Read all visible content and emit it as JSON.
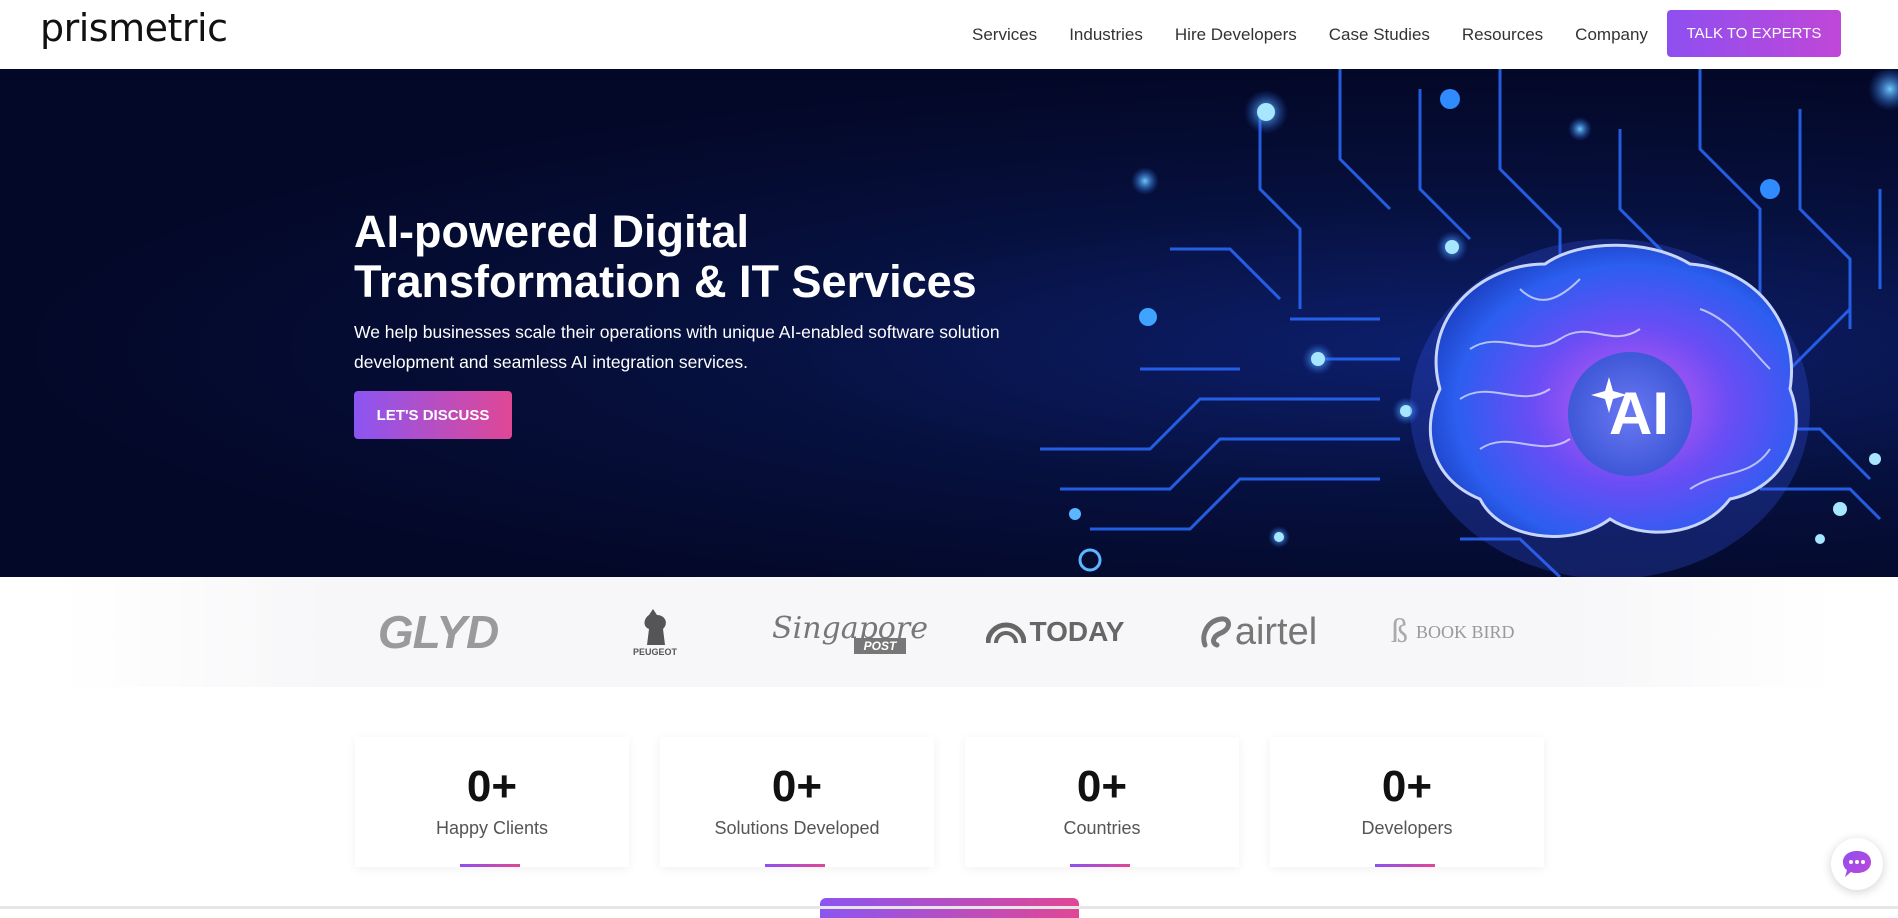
{
  "header": {
    "logo": "prismetric",
    "nav": [
      "Services",
      "Industries",
      "Hire Developers",
      "Case Studies",
      "Resources",
      "Company"
    ],
    "cta": "TALK TO EXPERTS"
  },
  "hero": {
    "title_line1": "AI-powered Digital",
    "title_line2": "Transformation & IT Services",
    "subtitle": "We help businesses scale their operations with unique AI-enabled software solution development and seamless AI integration services.",
    "button": "LET'S DISCUSS",
    "badge_text": "AI"
  },
  "clients": {
    "glyd": "GLYD",
    "peugeot": "PEUGEOT",
    "singapore": "Singapore",
    "singapore_post": "POST",
    "today": "TODAY",
    "airtel": "airtel",
    "bookbird": "BOOK BIRD"
  },
  "stats": [
    {
      "value": "0+",
      "label": "Happy Clients"
    },
    {
      "value": "0+",
      "label": "Solutions Developed"
    },
    {
      "value": "0+",
      "label": "Countries"
    },
    {
      "value": "0+",
      "label": "Developers"
    }
  ],
  "colors": {
    "accent_start": "#8e4ff0",
    "accent_end": "#e04795",
    "hero_bg": "#040828"
  },
  "icons": {
    "chat": "chat-bubble-icon"
  }
}
